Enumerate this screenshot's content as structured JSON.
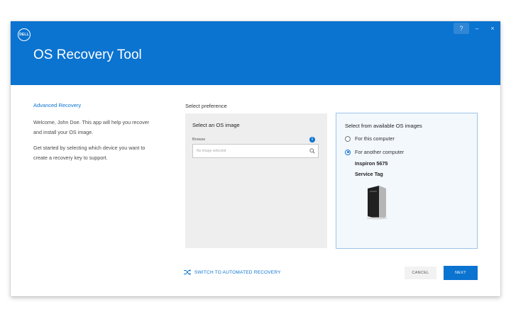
{
  "app": {
    "logo_text": "DELL",
    "title": "OS Recovery Tool",
    "window_controls": {
      "help": "?",
      "minimize": "–",
      "close": "×"
    }
  },
  "sidebar": {
    "heading": "Advanced Recovery",
    "paragraph1": "Welcome, John Doe. This app will help you recover and install your OS image.",
    "paragraph2": "Get started by selecting which device you want to create a recovery key to support."
  },
  "main": {
    "preference_label": "Select preference",
    "os_image_panel": {
      "title": "Select an OS image",
      "browse_label": "Browse",
      "info_icon": "i",
      "browse_placeholder": "No image selected"
    },
    "available_panel": {
      "title": "Select from available OS images",
      "options": [
        {
          "label": "For this computer",
          "selected": false
        },
        {
          "label": "For another computer",
          "selected": true
        }
      ],
      "model": "Inspiron 5675",
      "service_tag": "Service Tag"
    }
  },
  "footer": {
    "switch_link": "SWITCH TO AUTOMATED RECOVERY",
    "cancel_label": "CANCEL",
    "next_label": "NEXT"
  },
  "colors": {
    "accent": "#0b73d0",
    "header_bg": "#0b73d0",
    "selected_panel_border": "#9cc4ea"
  }
}
